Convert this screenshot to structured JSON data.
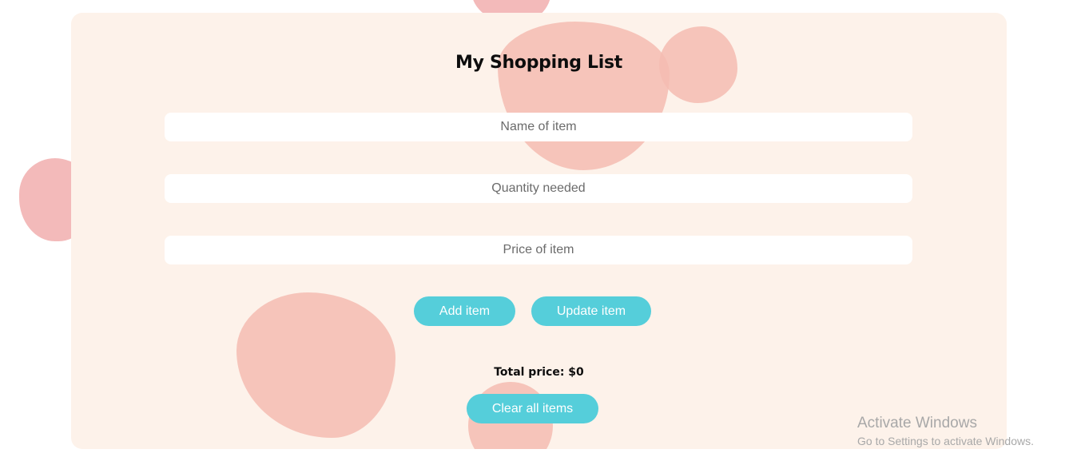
{
  "app": {
    "title": "My Shopping List"
  },
  "form": {
    "name_placeholder": "Name of item",
    "name_value": "",
    "quantity_placeholder": "Quantity needed",
    "quantity_value": "",
    "price_placeholder": "Price of item",
    "price_value": ""
  },
  "actions": {
    "add_label": "Add item",
    "update_label": "Update item",
    "clear_label": "Clear all items"
  },
  "summary": {
    "total_label": "Total price: $0"
  },
  "watermark": {
    "title": "Activate Windows",
    "subtitle": "Go to Settings to activate Windows."
  },
  "colors": {
    "card_background": "#fdf2ea",
    "blob": "#f5bcb1",
    "button": "#55ceda",
    "button_text": "#ffffff"
  }
}
